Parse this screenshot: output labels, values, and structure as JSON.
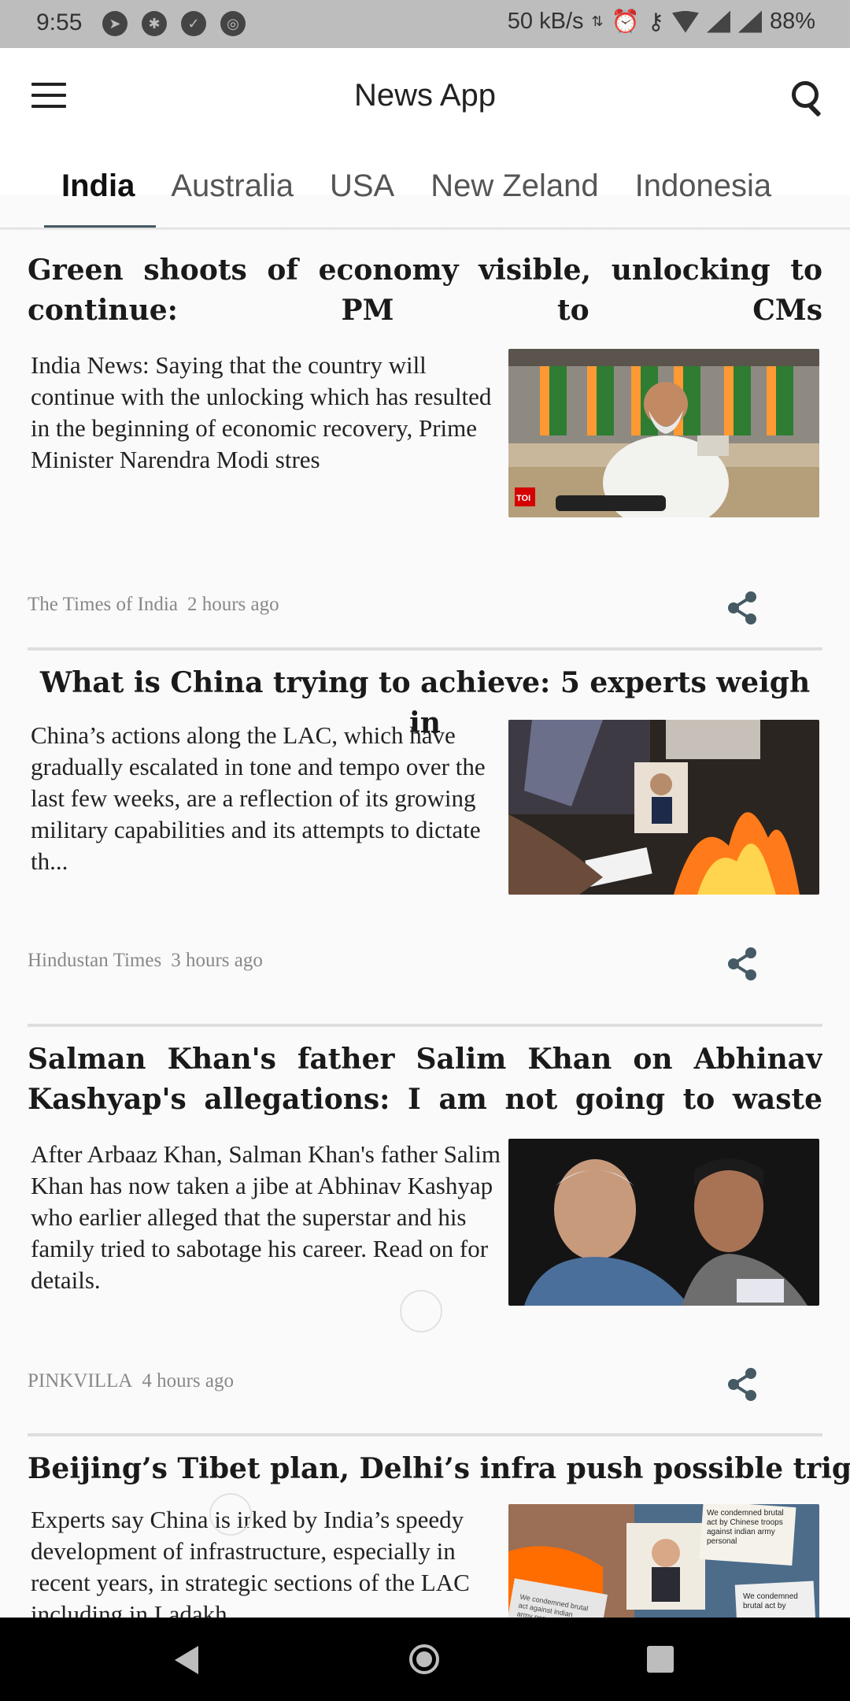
{
  "status_bar": {
    "time": "9:55",
    "speed": "50 kB/s",
    "battery": "88%",
    "left_icons": [
      "telegram-icon",
      "settings-icon",
      "shield-icon",
      "vpn-icon"
    ]
  },
  "app": {
    "title": "News App",
    "tabs": [
      "India",
      "Australia",
      "USA",
      "New Zeland",
      "Indonesia"
    ],
    "active_tab": "India"
  },
  "articles": [
    {
      "headline": "Green shoots of economy visible, unlocking to continue: PM to CMs",
      "description": "India News:  Saying that the country will continue with the unlocking which has resulted in the beginning of economic recovery, Prime Minister Narendra Modi stres",
      "source": "The Times of India",
      "time": "2 hours ago",
      "image_badge": "TOI"
    },
    {
      "headline": "What is China trying to achieve: 5 experts weigh in",
      "description": "China’s actions along the LAC, which have gradually escalated in tone and tempo over the last few weeks, are a reflection of its growing military capabilities and its attempts to dictate th...",
      "source": "Hindustan Times",
      "time": "3 hours ago"
    },
    {
      "headline": "Salman Khan's father Salim Khan on Abhinav Kashyap's allegations: I am not going to waste time in...",
      "description": "After Arbaaz Khan, Salman Khan's father Salim Khan has now taken a jibe at Abhinav Kashyap who earlier alleged that the superstar and his family tried to sabotage his career. Read on for details.",
      "source": "PINKVILLA",
      "time": "4 hours ago"
    },
    {
      "headline": "Beijing’s Tibet plan, Delhi’s infra push possible triggers",
      "description": "Experts say China is irked by India’s speedy development of infrastructure, especially in recent years, in strategic sections of the LAC including in Ladakh",
      "source": "",
      "time": "",
      "image_signs": [
        "We condemned brutal act by Chinese troops against indian army personal",
        "We condemned brutal act against indian army personal",
        "We condemned brutal act by"
      ]
    }
  ]
}
